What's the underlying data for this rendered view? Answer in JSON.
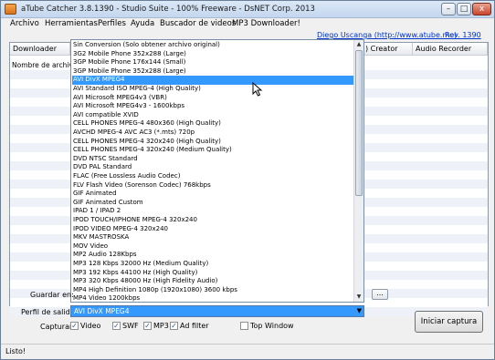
{
  "window": {
    "title": "aTube Catcher 3.8.1390 - Studio Suite - 100% Freeware - DsNET Corp. 2013",
    "minimize": "–",
    "maximize": "□",
    "close": "x"
  },
  "menu": [
    "Archivo",
    "Herramientas",
    "Perfiles",
    "Ayuda",
    "Buscador de videos",
    "MP3 Downloader!"
  ],
  "links": {
    "author": "Diego Uscanga (http://www.atube.me)",
    "revision": "Rev. 1390"
  },
  "tabs": {
    "downloader": "Downloader",
    "creator_partial": ") Creator",
    "audio_recorder": "Audio Recorder"
  },
  "downloader": {
    "filename_label": "Nombre de archivo"
  },
  "dropdown": {
    "items": [
      "Sin Conversion (Solo obtener archivo original)",
      "3G2 Mobile Phone 352x288 (Large)",
      "3GP Mobile Phone 176x144 (Small)",
      "3GP Mobile Phone 352x288 (Large)",
      "AVI DivX MPEG4",
      "AVI Standard ISO MPEG-4 (High Quality)",
      "AVI Microsoft MPEG4v3 (VBR)",
      "AVI Microsoft MPEG4v3 - 1600kbps",
      "AVI compatible XVID",
      "CELL PHONES MPEG-4 480x360 (High Quality)",
      "AVCHD MPEG-4 AVC AC3 (*.mts) 720p",
      "CELL PHONES MPEG-4 320x240 (High Quality)",
      "CELL PHONES MPEG-4 320x240 (Medium Quality)",
      "DVD NTSC Standard",
      "DVD PAL Standard",
      "FLAC (Free Lossless Audio Codec)",
      "FLV Flash Video (Sorenson Codec) 768kbps",
      "GIF Animated",
      "GIF Animated Custom",
      "IPAD 1 / IPAD 2",
      "IPOD TOUCH/IPHONE MPEG-4 320x240",
      "IPOD VIDEO MPEG-4 320x240",
      "MKV MASTROSKA",
      "MOV Video",
      "MP2 Audio 128Kbps",
      "MP3 128 Kbps 32000 Hz (Medium Quality)",
      "MP3 192 Kbps 44100 Hz (High Quality)",
      "MP3 320 Kbps 48000 Hz (High Fidelity Audio)",
      "MP4 High Definition 1080p (1920x1080) 3600 kbps",
      "MP4 Video 1200kbps"
    ],
    "selected_index": 4
  },
  "form": {
    "save_in_label": "Guardar en:",
    "browse_label": "...",
    "output_profile_label": "Perfil de salida",
    "output_profile_value": "AVI DivX MPEG4",
    "capture_label": "Capturar",
    "start_button": "Iniciar captura"
  },
  "capture_options": [
    {
      "label": "Video",
      "checked": true
    },
    {
      "label": "SWF",
      "checked": true
    },
    {
      "label": "MP3",
      "checked": true
    },
    {
      "label": "Ad filter",
      "checked": true
    },
    {
      "label": "Top Window",
      "checked": false
    }
  ],
  "status_text": "Listo!"
}
